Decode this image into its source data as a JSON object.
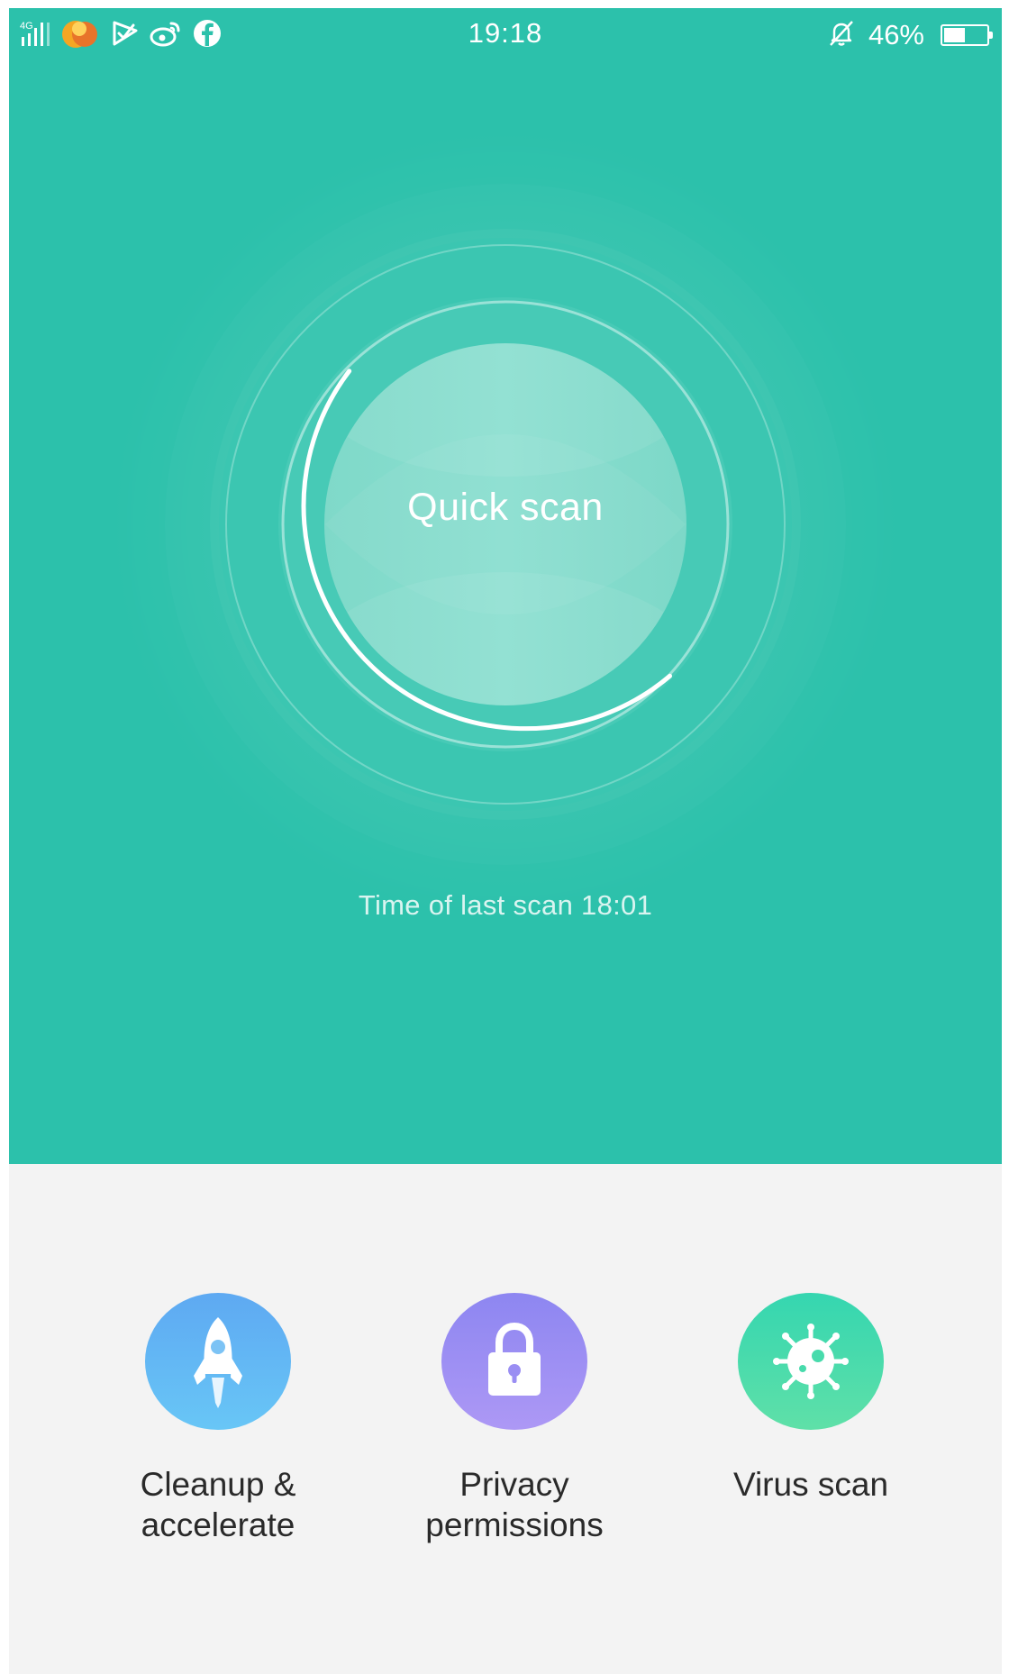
{
  "colors": {
    "accent": "#2cc1ab",
    "panel_background": "#f3f3f3"
  },
  "status_bar": {
    "time": "19:18",
    "battery_percent": "46%",
    "battery_level": 0.46,
    "network_label": "4G",
    "icons": [
      "signal-icon",
      "app-notification-icon",
      "check-app-icon",
      "weibo-icon",
      "facebook-icon",
      "silent-bell-icon",
      "battery-icon"
    ]
  },
  "scan": {
    "button_label": "Quick scan",
    "last_scan_text": "Time of last scan 18:01"
  },
  "features": [
    {
      "label": "Cleanup &\naccelerate",
      "icon": "rocket-icon"
    },
    {
      "label": "Privacy\npermissions",
      "icon": "lock-icon"
    },
    {
      "label": "Virus scan",
      "icon": "virus-icon"
    }
  ]
}
